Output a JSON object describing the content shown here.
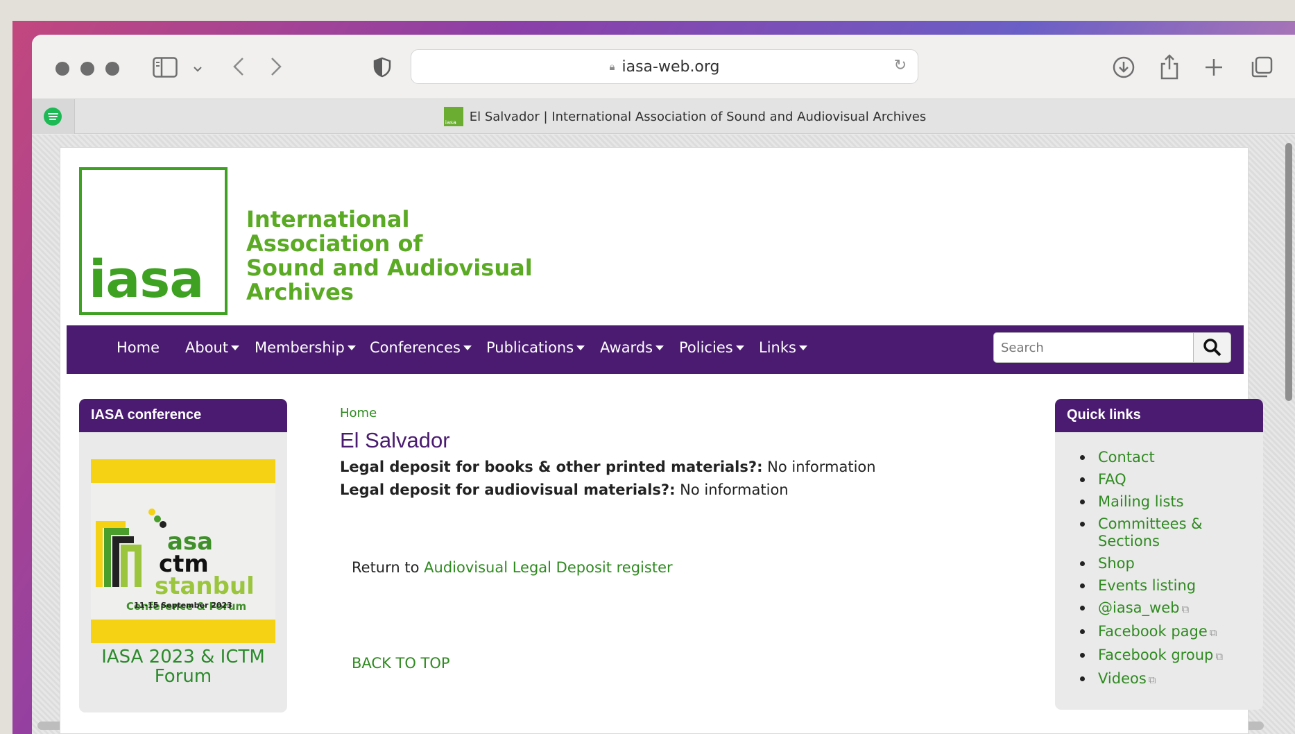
{
  "browser": {
    "url": "iasa-web.org",
    "tab_title": "El Salvador | International Association of Sound and Audiovisual Archives",
    "favicon_text": "iasa"
  },
  "site": {
    "logo_text": "iasa",
    "org_name_lines": [
      "International",
      "Association of",
      "Sound and Audiovisual",
      "Archives"
    ],
    "nav": [
      {
        "label": "Home",
        "dropdown": false
      },
      {
        "label": "About",
        "dropdown": true
      },
      {
        "label": "Membership",
        "dropdown": true
      },
      {
        "label": "Conferences",
        "dropdown": true
      },
      {
        "label": "Publications",
        "dropdown": true
      },
      {
        "label": "Awards",
        "dropdown": true
      },
      {
        "label": "Policies",
        "dropdown": true
      },
      {
        "label": "Links",
        "dropdown": true
      }
    ],
    "search_placeholder": "Search"
  },
  "sidebar_left": {
    "title": "IASA conference",
    "poster_lines": [
      "asa",
      "ctm",
      "stanbul",
      "Conference & Forum",
      "11-15 September 2023"
    ],
    "caption_lines": [
      "IASA 2023 & ICTM",
      "Forum"
    ]
  },
  "main": {
    "breadcrumb": "Home",
    "title": "El Salvador",
    "fields": [
      {
        "label": "Legal deposit for books & other printed materials?:",
        "value": "No information"
      },
      {
        "label": "Legal deposit for audiovisual materials?:",
        "value": "No information"
      }
    ],
    "return_prefix": "Return to",
    "return_link": "Audiovisual Legal Deposit register",
    "back_to_top": "BACK TO TOP"
  },
  "quick_links": {
    "title": "Quick links",
    "items": [
      {
        "label": "Contact",
        "external": false
      },
      {
        "label": "FAQ",
        "external": false
      },
      {
        "label": "Mailing lists",
        "external": false
      },
      {
        "label": "Committees & Sections",
        "external": false
      },
      {
        "label": "Shop",
        "external": false
      },
      {
        "label": "Events listing",
        "external": false
      },
      {
        "label": "@iasa_web",
        "external": true
      },
      {
        "label": "Facebook page",
        "external": true
      },
      {
        "label": "Facebook group",
        "external": true
      },
      {
        "label": "Videos",
        "external": true
      }
    ]
  },
  "colors": {
    "brand_green": "#3ea121",
    "nav_purple": "#4a1b70",
    "link_green": "#2f8a20"
  }
}
